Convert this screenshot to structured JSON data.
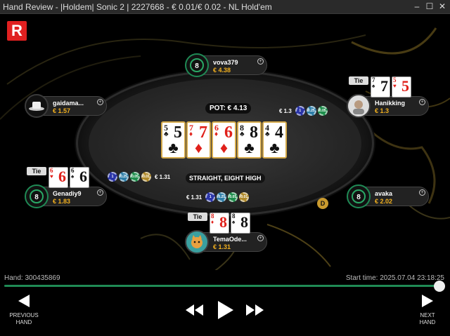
{
  "window": {
    "title": "Hand Review - |Holdem| Sonic 2 | 2227668 - € 0.01/€ 0.02 - NL Hold'em"
  },
  "pot_label": "POT: € 4.13",
  "board": [
    {
      "rank": "5",
      "suit": "♣",
      "color": "black"
    },
    {
      "rank": "7",
      "suit": "♦",
      "color": "red"
    },
    {
      "rank": "6",
      "suit": "♦",
      "color": "red"
    },
    {
      "rank": "8",
      "suit": "♣",
      "color": "black"
    },
    {
      "rank": "4",
      "suit": "♣",
      "color": "black"
    }
  ],
  "hand_result": "STRAIGHT, EIGHT HIGH",
  "seats": {
    "top": {
      "name": "vova379",
      "stack": "€ 4.38",
      "avatar": "8-logo"
    },
    "left_upper": {
      "name": "gaidama...",
      "stack": "€ 1.57",
      "avatar": "hat-avatar"
    },
    "right_upper": {
      "name": "Hanikking",
      "stack": "€ 1.3",
      "avatar": "face-avatar"
    },
    "left_lower": {
      "name": "Genadiy9",
      "stack": "€ 1.83",
      "avatar": "8-logo"
    },
    "right_lower": {
      "name": "avaka",
      "stack": "€ 2.02",
      "avatar": "8-logo"
    },
    "bottom": {
      "name": "TemaOde...",
      "stack": "€ 1.31",
      "avatar": "cat-avatar"
    }
  },
  "hole_cards": {
    "right_upper": {
      "tie": "Tie",
      "cards": [
        {
          "rank": "7",
          "suit": "♠",
          "color": "black"
        },
        {
          "rank": "5",
          "suit": "♥",
          "color": "red"
        }
      ]
    },
    "left_lower": {
      "tie": "Tie",
      "cards": [
        {
          "rank": "6",
          "suit": "♥",
          "color": "red"
        },
        {
          "rank": "6",
          "suit": "♠",
          "color": "black"
        }
      ]
    },
    "bottom": {
      "tie": "Tie",
      "cards": [
        {
          "rank": "8",
          "suit": "♦",
          "color": "red"
        },
        {
          "rank": "8",
          "suit": "♠",
          "color": "black"
        }
      ]
    }
  },
  "bets": {
    "right_upper": {
      "amount": "€ 1.3",
      "chips": [
        "1",
        "0.25",
        "0.05"
      ]
    },
    "left_lower": {
      "amount": "€ 1.31",
      "chips": [
        "1",
        "0.25",
        "0.05",
        "0.01"
      ]
    },
    "bottom": {
      "amount": "€ 1.31",
      "chips": [
        "1",
        "0.25",
        "0.05",
        "0.01"
      ]
    }
  },
  "dealer_button": "D",
  "hand_id_label": "Hand: 300435869",
  "start_time_label": "Start time: 2025.07.04 23:18:25",
  "nav": {
    "previous_line1": "PREVIOUS",
    "previous_line2": "HAND",
    "next_line1": "NEXT",
    "next_line2": "HAND"
  },
  "logo": "R",
  "colors": {
    "accent_green": "#1f8a55",
    "stack_gold": "#f2b01e",
    "card_border": "#d4a94a",
    "brand_red": "#e02020"
  }
}
